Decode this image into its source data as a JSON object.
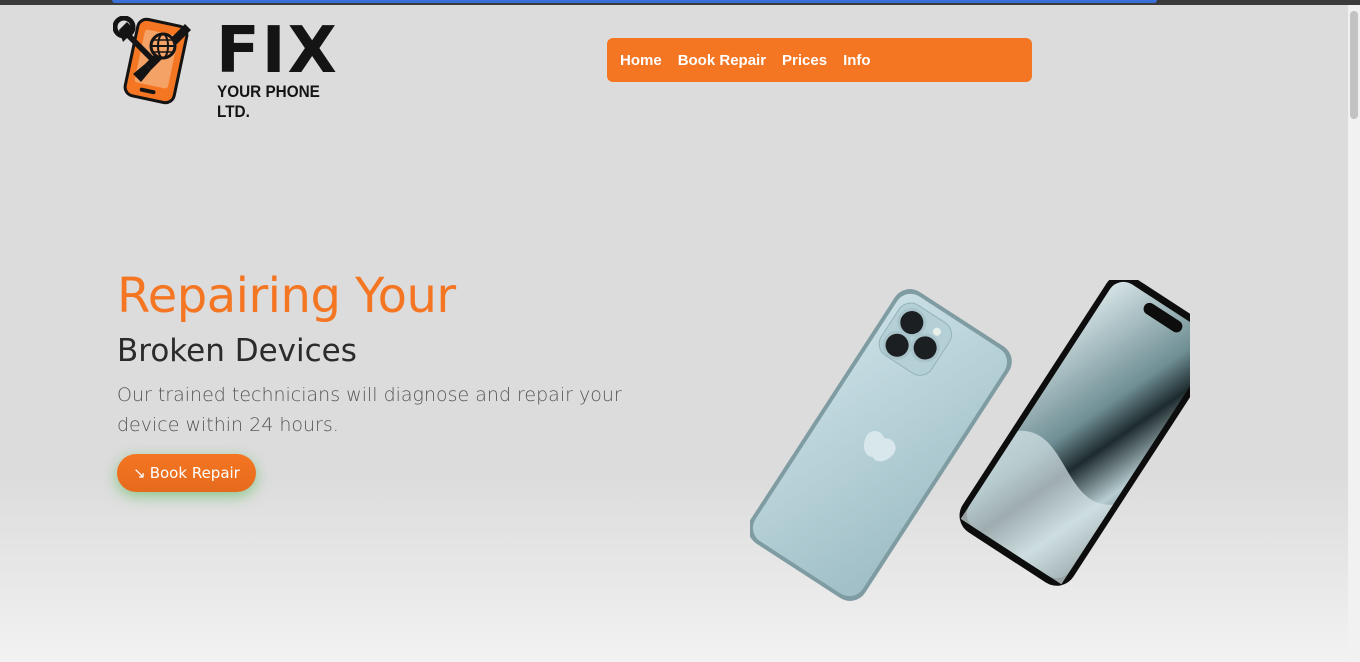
{
  "brand": {
    "logo_main": "FIX",
    "logo_sub": "YOUR PHONE LTD."
  },
  "nav": {
    "items": [
      {
        "label": "Home"
      },
      {
        "label": "Book Repair"
      },
      {
        "label": "Prices"
      },
      {
        "label": "Info"
      }
    ]
  },
  "hero": {
    "title": "Repairing Your",
    "subtitle": "Broken Devices",
    "description": "Our trained technicians will diagnose and repair your device within 24 hours.",
    "cta_icon": "↘",
    "cta_label": "Book Repair"
  },
  "colors": {
    "accent": "#f47623",
    "background": "#dcdcdc",
    "text_dark": "#2b2b2b"
  },
  "icons": {
    "logo": "phone-wrench-globe-icon",
    "cta": "arrow-down-right-icon",
    "hero_image": "smartphones-image"
  }
}
